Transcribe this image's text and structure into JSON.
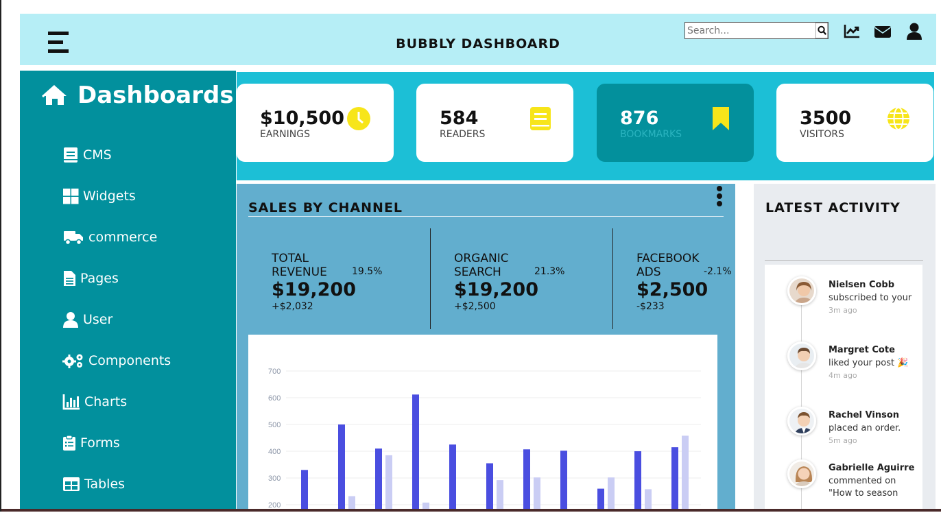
{
  "header": {
    "title": "BUBBLY DASHBOARD",
    "search_placeholder": "Search..."
  },
  "sidebar": {
    "title": "Dashboards",
    "items": [
      {
        "label": "CMS",
        "icon": "book-icon"
      },
      {
        "label": "Widgets",
        "icon": "widgets-icon"
      },
      {
        "label": "commerce",
        "icon": "truck-icon"
      },
      {
        "label": "Pages",
        "icon": "file-icon"
      },
      {
        "label": "User",
        "icon": "user-icon"
      },
      {
        "label": "Components",
        "icon": "cogs-icon"
      },
      {
        "label": "Charts",
        "icon": "chart-icon"
      },
      {
        "label": "Forms",
        "icon": "clipboard-icon"
      },
      {
        "label": "Tables",
        "icon": "table-icon"
      }
    ]
  },
  "cards": [
    {
      "value": "$10,500",
      "label": "EARNINGS",
      "icon": "clock-icon",
      "color": "#f7e51a"
    },
    {
      "value": "584",
      "label": "READERS",
      "icon": "book-icon",
      "color": "#f7e51a"
    },
    {
      "value": "876",
      "label": "BOOKMARKS",
      "icon": "bookmark-icon",
      "color": "#f7e51a"
    },
    {
      "value": "3500",
      "label": "VISITORS",
      "icon": "globe-icon",
      "color": "#f7e51a"
    }
  ],
  "sales": {
    "title": "SALES BY CHANNEL",
    "stats": [
      {
        "name": "TOTAL REVENUE",
        "pct": "19.5%",
        "value": "$19,200",
        "delta": "+$2,032"
      },
      {
        "name": "ORGANIC SEARCH",
        "pct": "21.3%",
        "value": "$19,200",
        "delta": "+$2,500"
      },
      {
        "name": "FACEBOOK ADS",
        "pct": "-2.1%",
        "value": "$2,500",
        "delta": "-$233"
      }
    ]
  },
  "chart_data": {
    "type": "bar",
    "y_ticks": [
      200,
      300,
      400,
      500,
      600,
      700
    ],
    "ylim": [
      200,
      700
    ],
    "grid": true,
    "series": [
      {
        "values": [
          330,
          500,
          410,
          612,
          425,
          355,
          407,
          402,
          260,
          400,
          415
        ],
        "color": "#4a4ee0"
      },
      {
        "values": [
          null,
          232,
          385,
          208,
          null,
          292,
          302,
          null,
          302,
          258,
          458
        ],
        "color": "#cacdf4"
      }
    ]
  },
  "activity": {
    "title": "LATEST ACTIVITY",
    "items": [
      {
        "name": "Nielsen Cobb",
        "text": "subscribed to your",
        "time": "3m ago"
      },
      {
        "name": "Margret Cote",
        "text": "liked your post 🎉",
        "time": "4m ago"
      },
      {
        "name": "Rachel Vinson",
        "text": "placed an order.",
        "time": "5m ago"
      },
      {
        "name": "Gabrielle Aguirre",
        "text": "commented on \"How to season",
        "time": ""
      }
    ]
  }
}
